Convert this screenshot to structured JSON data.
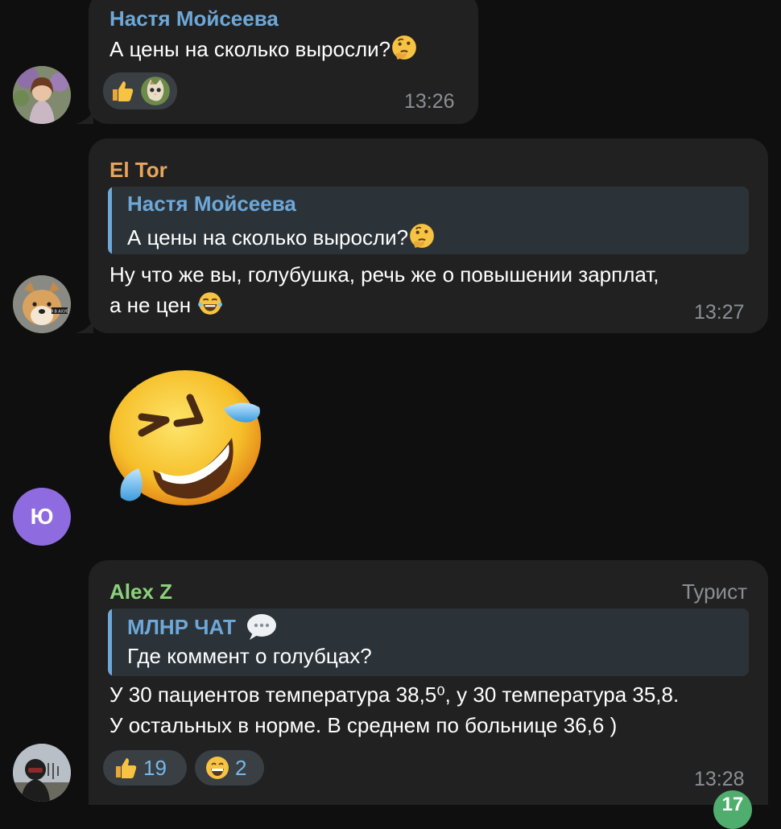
{
  "messages": [
    {
      "sender": "Настя Мойсеева",
      "text": "А цены на сколько выросли?",
      "time": "13:26",
      "reactions": [
        {
          "emoji": "thumbs-up-icon",
          "count": ""
        },
        {
          "emoji": "cat-sticker-icon",
          "count": ""
        }
      ]
    },
    {
      "sender": "El Tor",
      "reply_to": {
        "name": "Настя Мойсеева",
        "text": "А цены на сколько выросли?"
      },
      "text_line1": "Ну что же вы, голубушка, речь же о повышении зарплат,",
      "text_line2": "а не цен",
      "time": "13:27"
    },
    {
      "sender_initial": "Ю",
      "sticker": "rolling-on-floor-laughing-emoji"
    },
    {
      "sender": "Alex Z",
      "title": "Турист",
      "reply_to": {
        "name": "МЛНР ЧАТ",
        "text": "Где коммент о голубцах?"
      },
      "text_line1": "У 30 пациентов температура 38,5⁰, у 30 температура 35,8.",
      "text_line2": "У остальных в норме. В среднем по больнице 36,6 )",
      "time": "13:28",
      "reactions": [
        {
          "emoji": "thumbs-up-icon",
          "count": "19"
        },
        {
          "emoji": "grinning-face-icon",
          "count": "2"
        }
      ]
    }
  ],
  "unread_badge": "17",
  "colors": {
    "background": "#0f0f0f",
    "bubble": "#212121",
    "sender_blue": "#6ea8d8",
    "sender_orange": "#e9a55b",
    "sender_green": "#8bd17c",
    "avatar_purple": "#8e6ce0",
    "unread_green": "#4fae6d"
  }
}
